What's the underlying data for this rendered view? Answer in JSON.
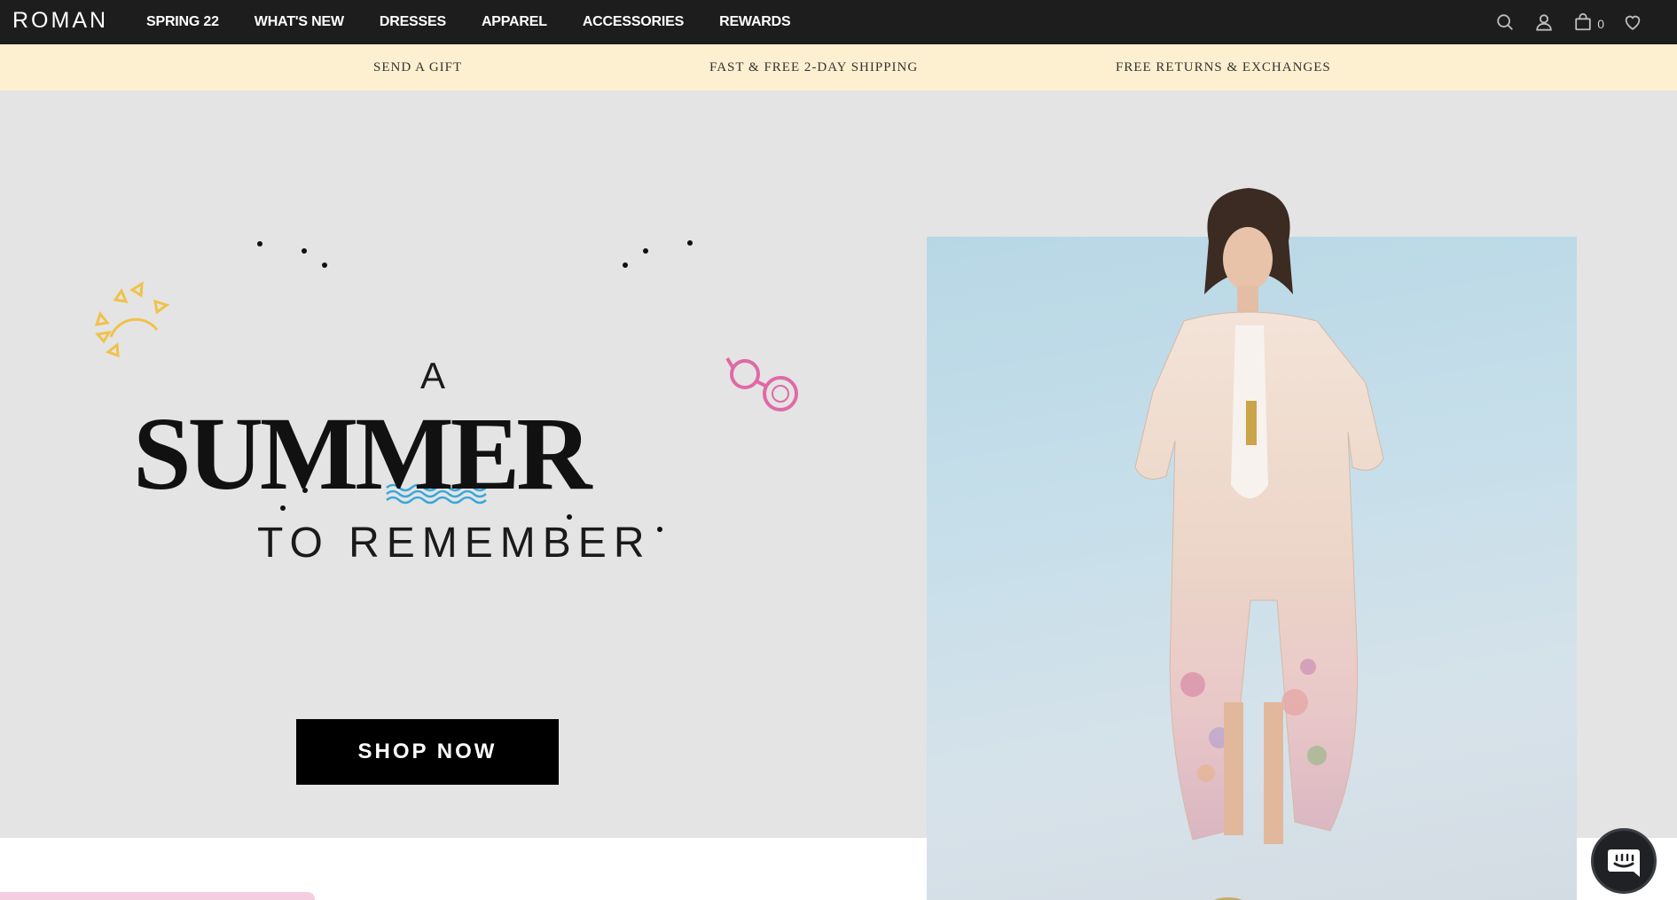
{
  "brand": {
    "logo_text": "ROMAN"
  },
  "nav": {
    "items": [
      {
        "label": "SPRING 22"
      },
      {
        "label": "WHAT'S NEW"
      },
      {
        "label": "DRESSES"
      },
      {
        "label": "APPAREL"
      },
      {
        "label": "ACCESSORIES"
      },
      {
        "label": "REWARDS"
      }
    ],
    "cart_count": "0",
    "icons": [
      "search-icon",
      "account-icon",
      "bag-icon",
      "heart-icon"
    ]
  },
  "promo_bar": {
    "items": [
      {
        "label": "SEND A GIFT"
      },
      {
        "label": "FAST & FREE 2-DAY SHIPPING"
      },
      {
        "label": "FREE RETURNS & EXCHANGES"
      }
    ],
    "background": "#fdf0d0"
  },
  "hero": {
    "headline_a": "A",
    "headline_main": "SUMMER",
    "headline_sub": "TO REMEMBER",
    "cta_label": "SHOP NOW",
    "background": "#e4e4e5"
  },
  "chat": {
    "icon": "chat-icon"
  },
  "colors": {
    "nav_bg": "#1d1d1d",
    "accent_pink": "#e06aa5",
    "accent_yellow": "#f0c24a",
    "accent_blue": "#3aa7d8"
  }
}
